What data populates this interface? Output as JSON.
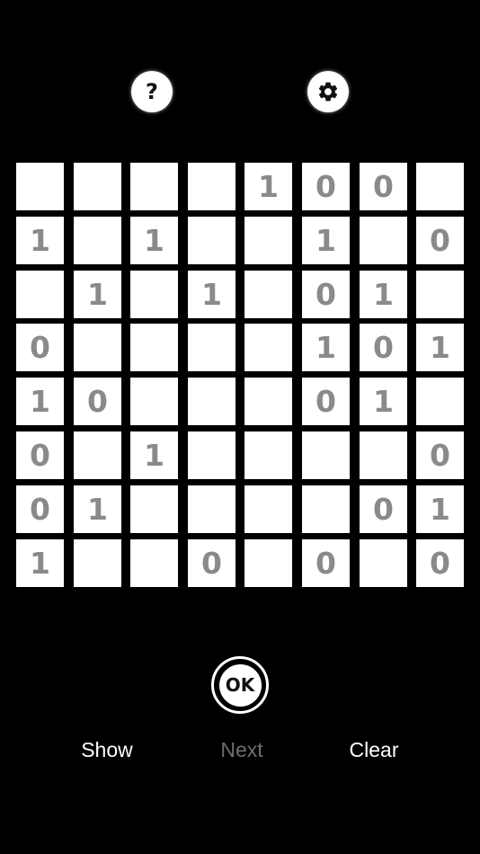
{
  "toolbar": {
    "help_icon": "question-mark-icon",
    "help_glyph": "?",
    "settings_icon": "gear-icon"
  },
  "board": {
    "rows": 8,
    "cols": 8,
    "cells": [
      [
        "",
        "",
        "",
        "",
        "1",
        "0",
        "0",
        ""
      ],
      [
        "1",
        "",
        "1",
        "",
        "",
        "1",
        "",
        "0"
      ],
      [
        "",
        "1",
        "",
        "1",
        "",
        "0",
        "1",
        ""
      ],
      [
        "0",
        "",
        "",
        "",
        "",
        "1",
        "0",
        "1"
      ],
      [
        "1",
        "0",
        "",
        "",
        "",
        "0",
        "1",
        ""
      ],
      [
        "0",
        "",
        "1",
        "",
        "",
        "",
        "",
        "0"
      ],
      [
        "0",
        "1",
        "",
        "",
        "",
        "",
        "0",
        "1"
      ],
      [
        "1",
        "",
        "",
        "0",
        "",
        "0",
        "",
        "0"
      ]
    ],
    "cell_color": "#ffffff",
    "digit_color": "#8a8a8a"
  },
  "controls": {
    "ok_label": "OK",
    "show_label": "Show",
    "next_label": "Next",
    "clear_label": "Clear",
    "next_enabled": false
  },
  "colors": {
    "background": "#000000",
    "text_enabled": "#ffffff",
    "text_disabled": "#6e6e6e"
  }
}
